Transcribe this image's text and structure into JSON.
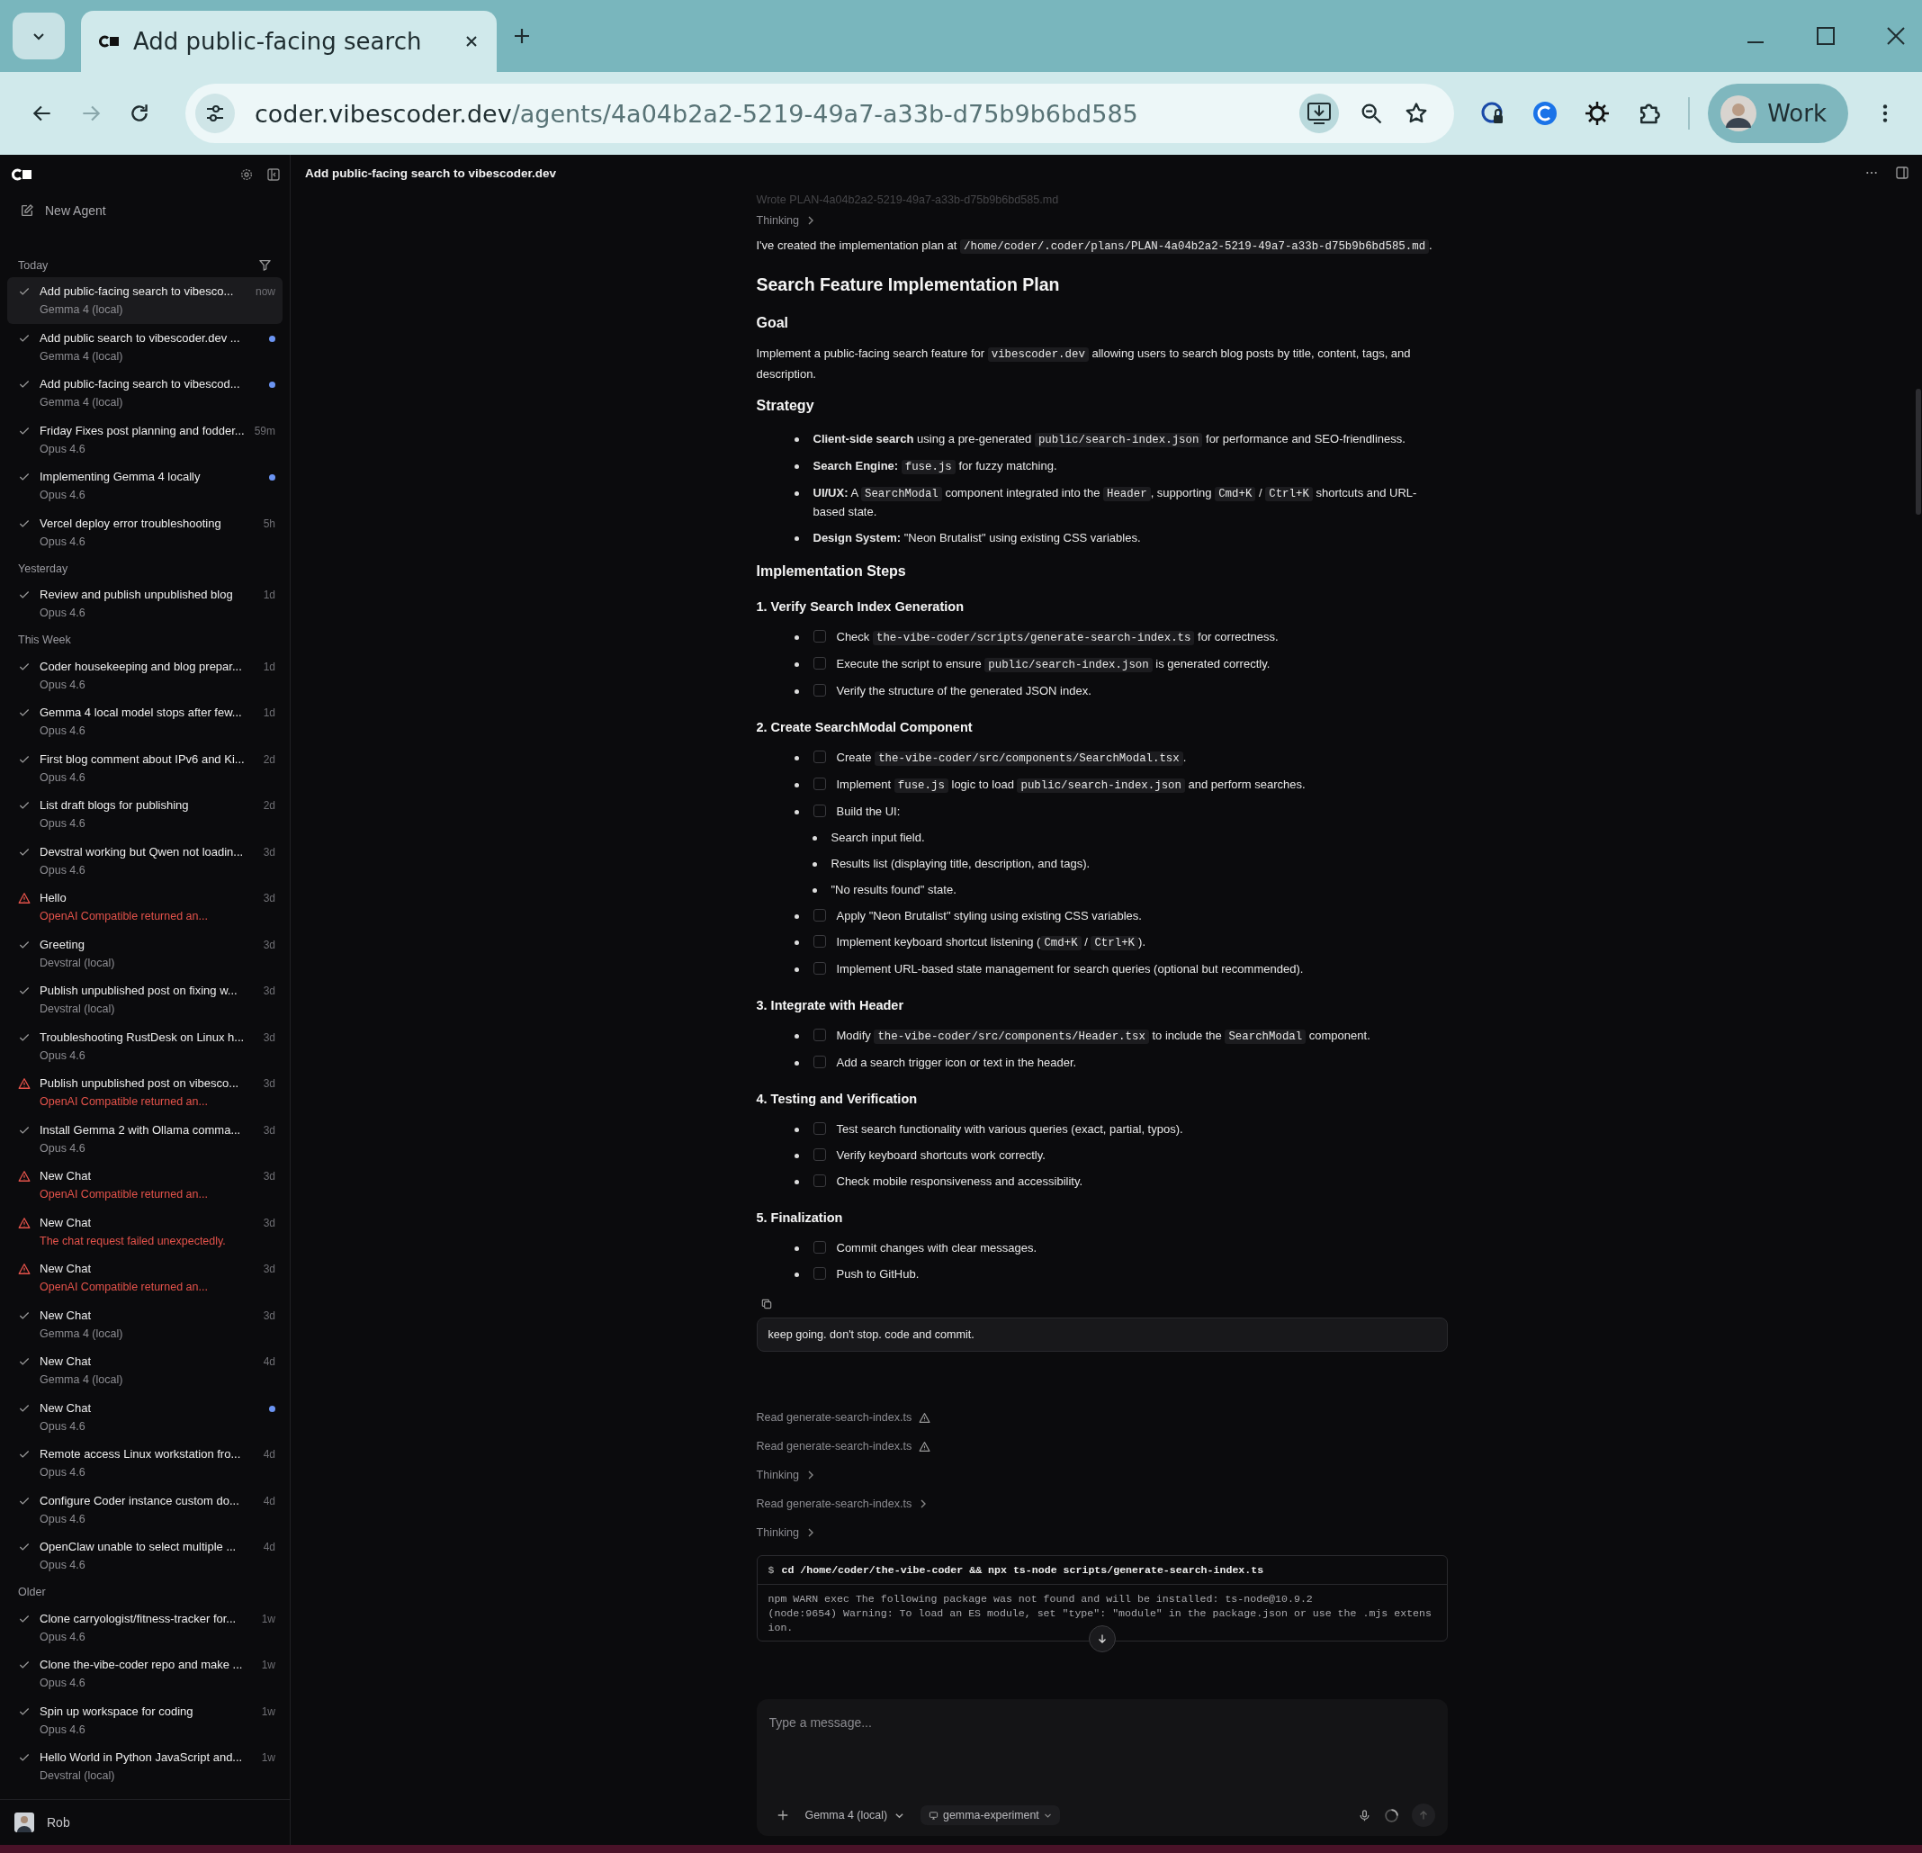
{
  "browser": {
    "tabs": [
      {
        "title": "Add public-facing search",
        "selected": true
      }
    ],
    "url": {
      "host": "coder.vibescoder.dev",
      "path": "/agents/4a04b2a2-5219-49a7-a33b-d75b9b6bd585"
    },
    "profile": "Work"
  },
  "app_header": {
    "title": "Add public-facing search to vibescoder.dev"
  },
  "sidebar": {
    "new_agent": "New Agent",
    "groups": [
      {
        "label": "Today",
        "items": [
          {
            "title": "Add public-facing search to vibesco...",
            "model": "Gemma 4 (local)",
            "time": "now",
            "failed": false,
            "unread": false,
            "selected": true
          },
          {
            "title": "Add public search to vibescoder.dev ...",
            "model": "Gemma 4 (local)",
            "failed": false,
            "unread": true,
            "selected": false
          },
          {
            "title": "Add public-facing search to vibescod...",
            "model": "Gemma 4 (local)",
            "failed": false,
            "unread": true,
            "selected": false
          },
          {
            "title": "Friday Fixes post planning and fodder...",
            "model": "Opus 4.6",
            "time": "59m",
            "failed": false,
            "unread": false,
            "selected": false
          },
          {
            "title": "Implementing Gemma 4 locally",
            "model": "Opus 4.6",
            "failed": false,
            "unread": true,
            "selected": false
          },
          {
            "title": "Vercel deploy error troubleshooting",
            "model": "Opus 4.6",
            "time": "5h",
            "failed": false,
            "unread": false,
            "selected": false
          }
        ]
      },
      {
        "label": "Yesterday",
        "items": [
          {
            "title": "Review and publish unpublished blog",
            "model": "Opus 4.6",
            "time": "1d",
            "failed": false,
            "unread": false,
            "selected": false
          }
        ]
      },
      {
        "label": "This Week",
        "items": [
          {
            "title": "Coder housekeeping and blog prepar...",
            "model": "Opus 4.6",
            "time": "1d",
            "failed": false,
            "unread": false,
            "selected": false
          },
          {
            "title": "Gemma 4 local model stops after few...",
            "model": "Opus 4.6",
            "time": "1d",
            "failed": false,
            "unread": false,
            "selected": false
          },
          {
            "title": "First blog comment about IPv6 and Ki...",
            "model": "Opus 4.6",
            "time": "2d",
            "failed": false,
            "unread": false,
            "selected": false
          },
          {
            "title": "List draft blogs for publishing",
            "model": "Opus 4.6",
            "time": "2d",
            "failed": false,
            "unread": false,
            "selected": false
          },
          {
            "title": "Devstral working but Qwen not loadin...",
            "model": "Opus 4.6",
            "time": "3d",
            "failed": false,
            "unread": false,
            "selected": false
          },
          {
            "title": "Hello",
            "model": "OpenAI Compatible returned an...",
            "time": "3d",
            "failed": true,
            "unread": false,
            "selected": false
          },
          {
            "title": "Greeting",
            "model": "Devstral (local)",
            "time": "3d",
            "failed": false,
            "unread": false,
            "selected": false
          },
          {
            "title": "Publish unpublished post on fixing w...",
            "model": "Devstral (local)",
            "time": "3d",
            "failed": false,
            "unread": false,
            "selected": false
          },
          {
            "title": "Troubleshooting RustDesk on Linux h...",
            "model": "Opus 4.6",
            "time": "3d",
            "failed": false,
            "unread": false,
            "selected": false
          },
          {
            "title": "Publish unpublished post on vibesco...",
            "model": "OpenAI Compatible returned an...",
            "time": "3d",
            "failed": true,
            "unread": false,
            "selected": false
          },
          {
            "title": "Install Gemma 2 with Ollama comma...",
            "model": "Opus 4.6",
            "time": "3d",
            "failed": false,
            "unread": false,
            "selected": false
          },
          {
            "title": "New Chat",
            "model": "OpenAI Compatible returned an...",
            "time": "3d",
            "failed": true,
            "unread": false,
            "selected": false
          },
          {
            "title": "New Chat",
            "model": "The chat request failed unexpectedly.",
            "time": "3d",
            "failed": true,
            "unread": false,
            "selected": false
          },
          {
            "title": "New Chat",
            "model": "OpenAI Compatible returned an...",
            "time": "3d",
            "failed": true,
            "unread": false,
            "selected": false
          },
          {
            "title": "New Chat",
            "model": "Gemma 4 (local)",
            "time": "3d",
            "failed": false,
            "unread": false,
            "selected": false
          },
          {
            "title": "New Chat",
            "model": "Gemma 4 (local)",
            "time": "4d",
            "failed": false,
            "unread": false,
            "selected": false
          },
          {
            "title": "New Chat",
            "model": "Opus 4.6",
            "failed": false,
            "unread": true,
            "selected": false
          },
          {
            "title": "Remote access Linux workstation fro...",
            "model": "Opus 4.6",
            "time": "4d",
            "failed": false,
            "unread": false,
            "selected": false
          },
          {
            "title": "Configure Coder instance custom do...",
            "model": "Opus 4.6",
            "time": "4d",
            "failed": false,
            "unread": false,
            "selected": false
          },
          {
            "title": "OpenClaw unable to select multiple ...",
            "model": "Opus 4.6",
            "time": "4d",
            "failed": false,
            "unread": false,
            "selected": false
          }
        ]
      },
      {
        "label": "Older",
        "items": [
          {
            "title": "Clone carryologist/fitness-tracker for...",
            "model": "Opus 4.6",
            "time": "1w",
            "failed": false,
            "unread": false,
            "selected": false
          },
          {
            "title": "Clone the-vibe-coder repo and make ...",
            "model": "Opus 4.6",
            "time": "1w",
            "failed": false,
            "unread": false,
            "selected": false
          },
          {
            "title": "Spin up workspace for coding",
            "model": "Opus 4.6",
            "time": "1w",
            "failed": false,
            "unread": false,
            "selected": false
          },
          {
            "title": "Hello World in Python JavaScript and...",
            "model": "Devstral (local)",
            "time": "1w",
            "failed": false,
            "unread": false,
            "selected": false
          }
        ]
      }
    ],
    "user": "Rob"
  },
  "chat": {
    "top_steps": [
      {
        "kind": "tool",
        "text": "Wrote PLAN-4a04b2a2-5219-49a7-a33b-d75b9b6bd585.md"
      },
      {
        "kind": "expand",
        "text": "Thinking"
      }
    ],
    "plan": [
      {
        "kind": "paragraph",
        "parts": [
          {
            "kind": "text",
            "text": "I've created the implementation plan at "
          },
          {
            "kind": "code",
            "text": "/home/coder/.coder/plans/PLAN-4a04b2a2-5219-49a7-a33b-d75b9b6bd585.md"
          },
          {
            "kind": "text",
            "text": "."
          }
        ]
      },
      {
        "kind": "h1",
        "text": "Search Feature Implementation Plan"
      },
      {
        "kind": "h2",
        "text": "Goal"
      },
      {
        "kind": "paragraph",
        "parts": [
          {
            "kind": "text",
            "text": "Implement a public-facing search feature for "
          },
          {
            "kind": "code",
            "text": "vibescoder.dev"
          },
          {
            "kind": "text",
            "text": " allowing users to search blog posts by title, content, tags, and description."
          }
        ]
      },
      {
        "kind": "h2",
        "text": "Strategy"
      },
      {
        "kind": "list",
        "items": [
          {
            "parts": [
              {
                "kind": "bold",
                "text": "Client-side search"
              },
              {
                "kind": "text",
                "text": " using a pre-generated "
              },
              {
                "kind": "code",
                "text": "public/search-index.json"
              },
              {
                "kind": "text",
                "text": " for performance and SEO-friendliness."
              }
            ]
          },
          {
            "parts": [
              {
                "kind": "bold",
                "text": "Search Engine: "
              },
              {
                "kind": "code",
                "text": "fuse.js"
              },
              {
                "kind": "text",
                "text": " for fuzzy matching."
              }
            ]
          },
          {
            "parts": [
              {
                "kind": "bold",
                "text": "UI/UX:"
              },
              {
                "kind": "text",
                "text": " A "
              },
              {
                "kind": "code",
                "text": "SearchModal"
              },
              {
                "kind": "text",
                "text": " component integrated into the "
              },
              {
                "kind": "code",
                "text": "Header"
              },
              {
                "kind": "text",
                "text": ", supporting "
              },
              {
                "kind": "code",
                "text": "Cmd+K"
              },
              {
                "kind": "text",
                "text": " / "
              },
              {
                "kind": "code",
                "text": "Ctrl+K"
              },
              {
                "kind": "text",
                "text": " shortcuts and URL-based state."
              }
            ]
          },
          {
            "parts": [
              {
                "kind": "bold",
                "text": "Design System:"
              },
              {
                "kind": "text",
                "text": " \"Neon Brutalist\" using existing CSS variables."
              }
            ]
          }
        ]
      },
      {
        "kind": "h2",
        "text": "Implementation Steps"
      },
      {
        "kind": "h3",
        "text": "1. Verify Search Index Generation"
      },
      {
        "kind": "list",
        "items": [
          {
            "checked": false,
            "parts": [
              {
                "kind": "text",
                "text": "Check "
              },
              {
                "kind": "code",
                "text": "the-vibe-coder/scripts/generate-search-index.ts"
              },
              {
                "kind": "text",
                "text": " for correctness."
              }
            ]
          },
          {
            "checked": false,
            "parts": [
              {
                "kind": "text",
                "text": "Execute the script to ensure "
              },
              {
                "kind": "code",
                "text": "public/search-index.json"
              },
              {
                "kind": "text",
                "text": " is generated correctly."
              }
            ]
          },
          {
            "checked": false,
            "parts": [
              {
                "kind": "text",
                "text": "Verify the structure of the generated JSON index."
              }
            ]
          }
        ]
      },
      {
        "kind": "h3",
        "text": "2. Create SearchModal Component"
      },
      {
        "kind": "list",
        "items": [
          {
            "checked": false,
            "parts": [
              {
                "kind": "text",
                "text": "Create "
              },
              {
                "kind": "code",
                "text": "the-vibe-coder/src/components/SearchModal.tsx"
              },
              {
                "kind": "text",
                "text": "."
              }
            ]
          },
          {
            "checked": false,
            "parts": [
              {
                "kind": "text",
                "text": "Implement "
              },
              {
                "kind": "code",
                "text": "fuse.js"
              },
              {
                "kind": "text",
                "text": " logic to load "
              },
              {
                "kind": "code",
                "text": "public/search-index.json"
              },
              {
                "kind": "text",
                "text": " and perform searches."
              }
            ]
          },
          {
            "checked": false,
            "parts": [
              {
                "kind": "text",
                "text": "Build the UI:"
              }
            ],
            "children": [
              {
                "parts": [
                  {
                    "kind": "text",
                    "text": "Search input field."
                  }
                ]
              },
              {
                "parts": [
                  {
                    "kind": "text",
                    "text": "Results list (displaying title, description, and tags)."
                  }
                ]
              },
              {
                "parts": [
                  {
                    "kind": "text",
                    "text": "\"No results found\" state."
                  }
                ]
              }
            ]
          },
          {
            "checked": false,
            "parts": [
              {
                "kind": "text",
                "text": "Apply \"Neon Brutalist\" styling using existing CSS variables."
              }
            ]
          },
          {
            "checked": false,
            "parts": [
              {
                "kind": "text",
                "text": "Implement keyboard shortcut listening ("
              },
              {
                "kind": "code",
                "text": "Cmd+K"
              },
              {
                "kind": "text",
                "text": " / "
              },
              {
                "kind": "code",
                "text": "Ctrl+K"
              },
              {
                "kind": "text",
                "text": ")."
              }
            ]
          },
          {
            "checked": false,
            "parts": [
              {
                "kind": "text",
                "text": "Implement URL-based state management for search queries (optional but recommended)."
              }
            ]
          }
        ]
      },
      {
        "kind": "h3",
        "text": "3. Integrate with Header"
      },
      {
        "kind": "list",
        "items": [
          {
            "checked": false,
            "parts": [
              {
                "kind": "text",
                "text": "Modify "
              },
              {
                "kind": "code",
                "text": "the-vibe-coder/src/components/Header.tsx"
              },
              {
                "kind": "text",
                "text": " to include the "
              },
              {
                "kind": "code",
                "text": "SearchModal"
              },
              {
                "kind": "text",
                "text": " component."
              }
            ]
          },
          {
            "checked": false,
            "parts": [
              {
                "kind": "text",
                "text": "Add a search trigger icon or text in the header."
              }
            ]
          }
        ]
      },
      {
        "kind": "h3",
        "text": "4. Testing and Verification"
      },
      {
        "kind": "list",
        "items": [
          {
            "checked": false,
            "parts": [
              {
                "kind": "text",
                "text": "Test search functionality with various queries (exact, partial, typos)."
              }
            ]
          },
          {
            "checked": false,
            "parts": [
              {
                "kind": "text",
                "text": "Verify keyboard shortcuts work correctly."
              }
            ]
          },
          {
            "checked": false,
            "parts": [
              {
                "kind": "text",
                "text": "Check mobile responsiveness and accessibility."
              }
            ]
          }
        ]
      },
      {
        "kind": "h3",
        "text": "5. Finalization"
      },
      {
        "kind": "list",
        "items": [
          {
            "checked": false,
            "parts": [
              {
                "kind": "text",
                "text": "Commit changes with clear messages."
              }
            ]
          },
          {
            "checked": false,
            "parts": [
              {
                "kind": "text",
                "text": "Push to GitHub."
              }
            ]
          }
        ]
      }
    ],
    "user_message": "keep going. don't stop. code and commit.",
    "steps": [
      {
        "kind": "warning",
        "text": "Read generate-search-index.ts"
      },
      {
        "kind": "warning",
        "text": "Read generate-search-index.ts"
      },
      {
        "kind": "expand",
        "text": "Thinking"
      },
      {
        "kind": "expand",
        "text": "Read generate-search-index.ts"
      },
      {
        "kind": "expand",
        "text": "Thinking"
      }
    ],
    "terminal": {
      "prompt": "$",
      "command": "cd /home/coder/the-vibe-coder && npx ts-node scripts/generate-search-index.ts",
      "output": [
        "npm WARN exec The following package was not found and will be installed: ts-node@10.9.2",
        "(node:9654) Warning: To load an ES module, set \"type\": \"module\" in the package.json or use the .mjs extension."
      ]
    }
  },
  "composer": {
    "placeholder": "Type a message...",
    "model": "Gemma 4 (local)",
    "workspace": "gemma-experiment"
  }
}
